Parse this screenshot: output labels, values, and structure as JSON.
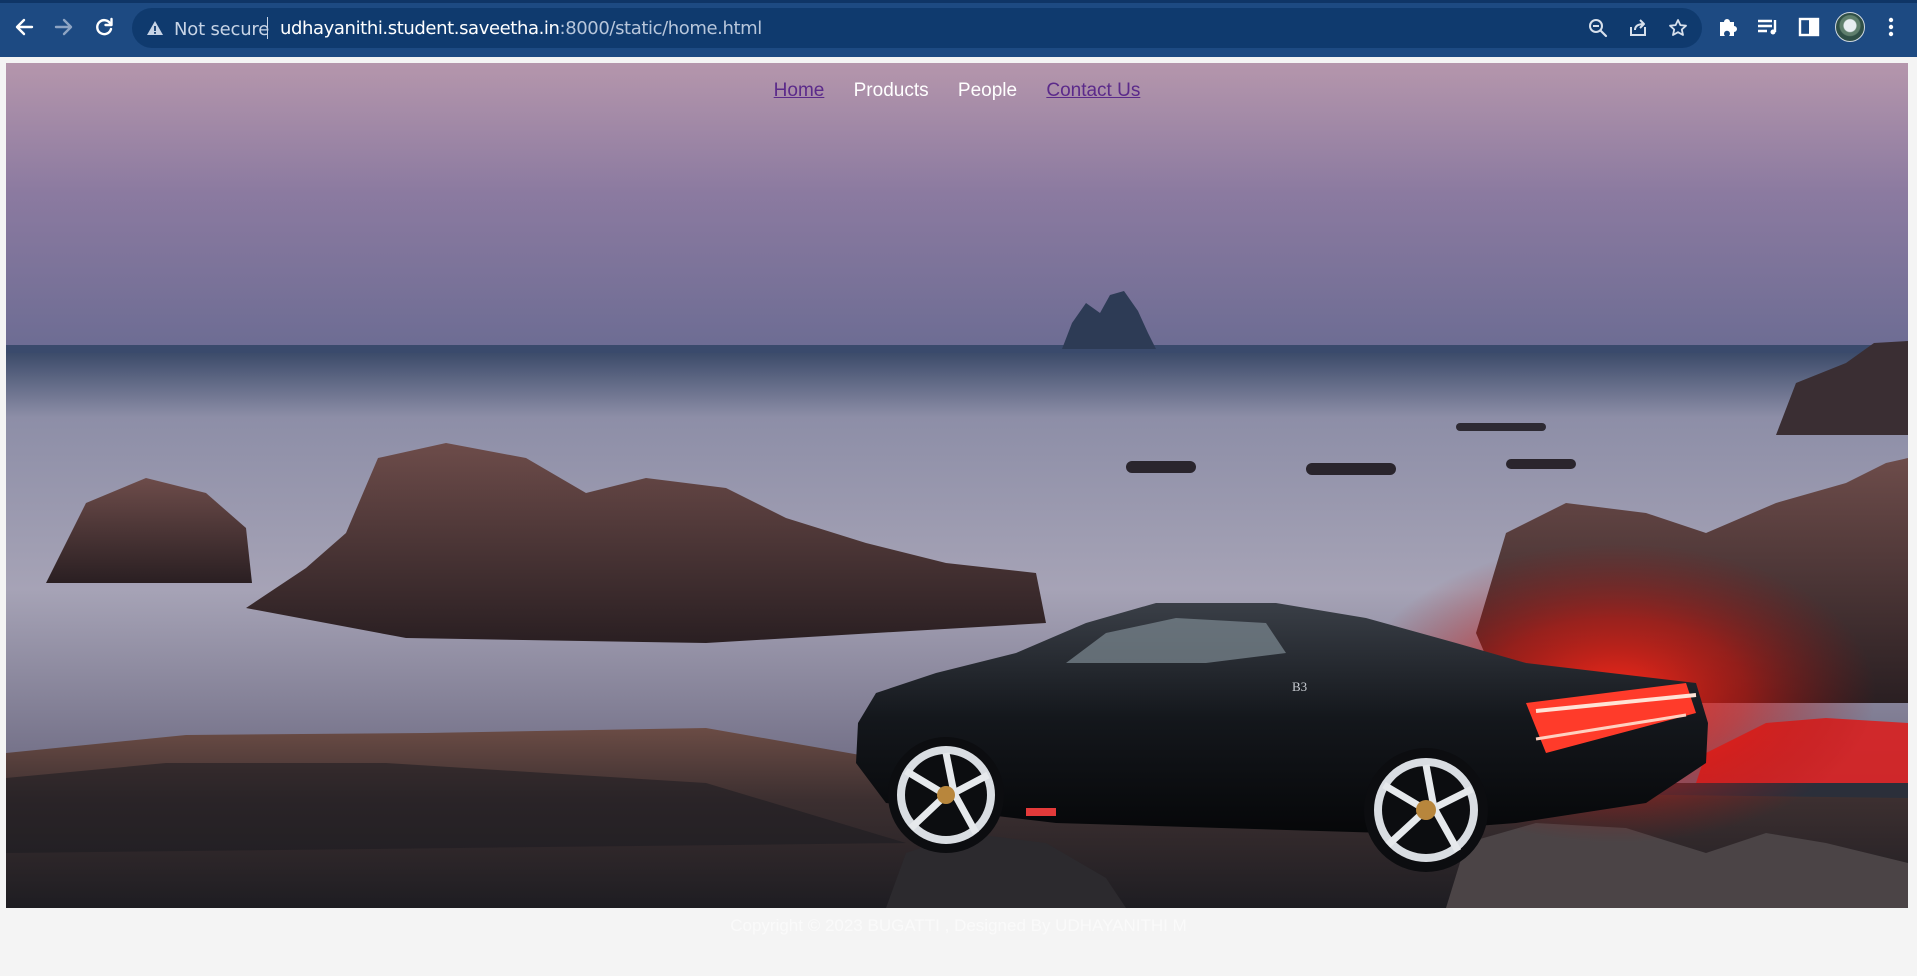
{
  "browser": {
    "security_label": "Not secure",
    "url_host": "udhayanithi.student.saveetha.in",
    "url_rest": ":8000/static/home.html"
  },
  "nav": {
    "home": "Home",
    "products": "Products",
    "people": "People",
    "contact": "Contact Us"
  },
  "hero": {
    "badge_text": "B3"
  },
  "footer": {
    "text": "Copyright © 2023 BUGATTI , Designed By UDHAYANITHI M"
  },
  "icons": {
    "back": "arrow-left-icon",
    "forward": "arrow-right-icon",
    "reload": "reload-icon",
    "warning": "warning-icon",
    "zoom": "zoom-out-icon",
    "share": "share-icon",
    "star": "star-icon",
    "extensions": "puzzle-icon",
    "reading_list": "reading-list-icon",
    "side_panel": "side-panel-icon",
    "profile": "avatar",
    "menu": "kebab-menu-icon"
  },
  "colors": {
    "chrome": "#1d4a82",
    "omnibox": "#0f3a6e",
    "link_visited": "#5b2a8a",
    "footer_text": "#fafafa",
    "page_bg": "#f4f4f4"
  }
}
